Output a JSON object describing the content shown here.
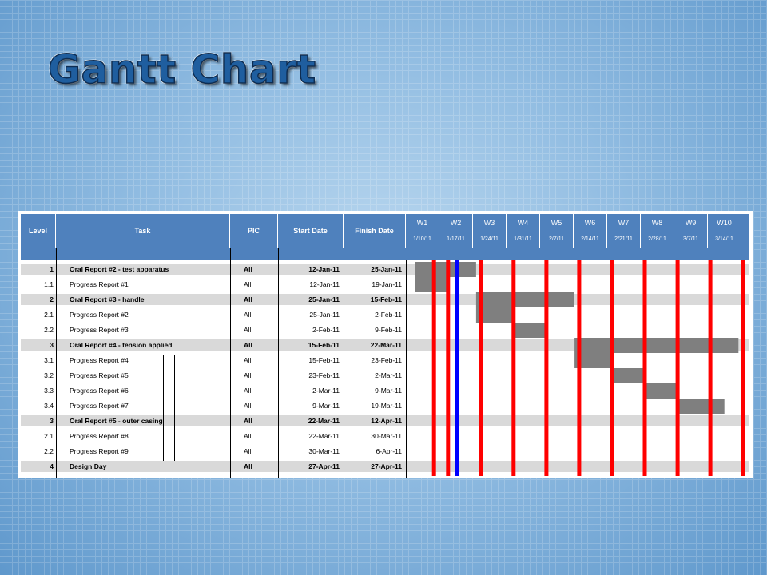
{
  "slide": {
    "title": "Gantt Chart"
  },
  "table": {
    "columns": [
      "Level",
      "Task",
      "PIC",
      "Start Date",
      "Finish Date"
    ]
  },
  "colors": {
    "header": "#4f81bd",
    "summary_band": "#d9d9d9",
    "bar": "#7f7f7f",
    "red_line": "#ff0000",
    "blue_line": "#0000ff"
  },
  "chart_data": {
    "type": "table",
    "weeks": [
      {
        "label": "W1",
        "date": "1/10/11"
      },
      {
        "label": "W2",
        "date": "1/17/11"
      },
      {
        "label": "W3",
        "date": "1/24/11"
      },
      {
        "label": "W4",
        "date": "1/31/11"
      },
      {
        "label": "W5",
        "date": "2/7/11"
      },
      {
        "label": "W6",
        "date": "2/14/11"
      },
      {
        "label": "W7",
        "date": "2/21/11"
      },
      {
        "label": "W8",
        "date": "2/28/11"
      },
      {
        "label": "W9",
        "date": "3/7/11"
      },
      {
        "label": "W10",
        "date": "3/14/11"
      }
    ],
    "tasks": [
      {
        "level": "1",
        "task": "Oral Report #2 - test apparatus",
        "pic": "All",
        "start": "12-Jan-11",
        "finish": "25-Jan-11",
        "summary": true
      },
      {
        "level": "1.1",
        "task": "Progress Report #1",
        "pic": "All",
        "start": "12-Jan-11",
        "finish": "19-Jan-11",
        "summary": false
      },
      {
        "level": "2",
        "task": "Oral Report #3 - handle",
        "pic": "All",
        "start": "25-Jan-11",
        "finish": "15-Feb-11",
        "summary": true
      },
      {
        "level": "2.1",
        "task": "Progress Report #2",
        "pic": "All",
        "start": "25-Jan-11",
        "finish": "2-Feb-11",
        "summary": false
      },
      {
        "level": "2.2",
        "task": "Progress Report #3",
        "pic": "All",
        "start": "2-Feb-11",
        "finish": "9-Feb-11",
        "summary": false
      },
      {
        "level": "3",
        "task": "Oral Report #4 - tension applied",
        "pic": "All",
        "start": "15-Feb-11",
        "finish": "22-Mar-11",
        "summary": true
      },
      {
        "level": "3.1",
        "task": "Progress Report #4",
        "pic": "All",
        "start": "15-Feb-11",
        "finish": "23-Feb-11",
        "summary": false
      },
      {
        "level": "3.2",
        "task": "Progress Report #5",
        "pic": "All",
        "start": "23-Feb-11",
        "finish": "2-Mar-11",
        "summary": false
      },
      {
        "level": "3.3",
        "task": "Progress Report #6",
        "pic": "All",
        "start": "2-Mar-11",
        "finish": "9-Mar-11",
        "summary": false
      },
      {
        "level": "3.4",
        "task": "Progress Report #7",
        "pic": "All",
        "start": "9-Mar-11",
        "finish": "19-Mar-11",
        "summary": false
      },
      {
        "level": "3",
        "task": "Oral Report #5 - outer casing",
        "pic": "All",
        "start": "22-Mar-11",
        "finish": "12-Apr-11",
        "summary": true
      },
      {
        "level": "2.1",
        "task": "Progress Report #8",
        "pic": "All",
        "start": "22-Mar-11",
        "finish": "30-Mar-11",
        "summary": false
      },
      {
        "level": "2.2",
        "task": "Progress Report #9",
        "pic": "All",
        "start": "30-Mar-11",
        "finish": "6-Apr-11",
        "summary": false
      },
      {
        "level": "4",
        "task": "Design Day",
        "pic": "All",
        "start": "27-Apr-11",
        "finish": "27-Apr-11",
        "summary": true
      }
    ],
    "bars": [
      {
        "row": 0,
        "start": "2011-01-12",
        "end": "2011-01-25"
      },
      {
        "row": 1,
        "start": "2011-01-12",
        "end": "2011-01-19"
      },
      {
        "row": 2,
        "start": "2011-01-25",
        "end": "2011-02-15"
      },
      {
        "row": 3,
        "start": "2011-01-25",
        "end": "2011-02-02"
      },
      {
        "row": 4,
        "start": "2011-02-02",
        "end": "2011-02-09"
      },
      {
        "row": 5,
        "start": "2011-02-15",
        "end": "2011-03-22"
      },
      {
        "row": 6,
        "start": "2011-02-15",
        "end": "2011-02-23"
      },
      {
        "row": 7,
        "start": "2011-02-23",
        "end": "2011-03-02"
      },
      {
        "row": 8,
        "start": "2011-03-02",
        "end": "2011-03-09"
      },
      {
        "row": 9,
        "start": "2011-03-09",
        "end": "2011-03-19"
      }
    ],
    "red_lines": [
      "2011-01-16",
      "2011-01-19",
      "2011-01-26",
      "2011-02-02",
      "2011-02-09",
      "2011-02-16",
      "2011-02-23",
      "2011-03-02",
      "2011-03-09",
      "2011-03-16",
      "2011-03-23"
    ],
    "blue_line": "2011-01-21",
    "axis_start": "2011-01-10",
    "axis_end": "2011-03-24"
  }
}
